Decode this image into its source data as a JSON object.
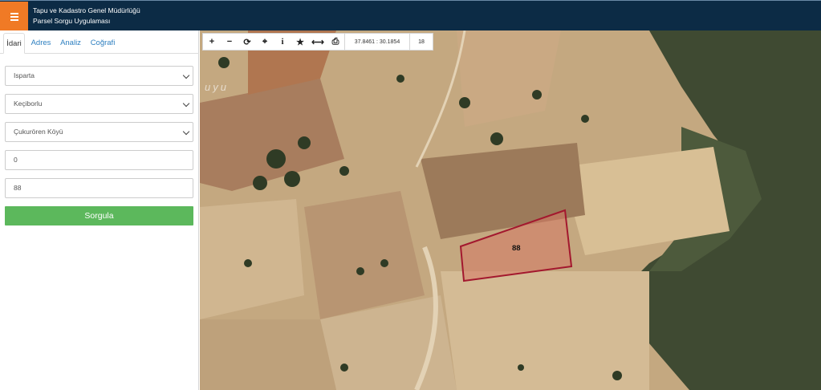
{
  "header": {
    "title": "Tapu ve Kadastro Genel Müdürlüğü",
    "subtitle": "Parsel Sorgu Uygulaması",
    "menu_icon": "hamburger-icon",
    "colors": {
      "background": "#0c2b45",
      "menu_button": "#f07a25"
    }
  },
  "sidebar": {
    "tabs": [
      {
        "label": "İdari",
        "active": true
      },
      {
        "label": "Adres"
      },
      {
        "label": "Analiz"
      },
      {
        "label": "Coğrafi"
      }
    ],
    "form": {
      "province": "Isparta",
      "district": "Keçiborlu",
      "neighborhood": "Çukurören Köyü",
      "block": "0",
      "parcel": "88",
      "submit_label": "Sorgula",
      "submit_color": "#5cb85c"
    }
  },
  "map": {
    "toolbar": {
      "zoom_in": "+",
      "zoom_out": "−",
      "refresh": "⟳",
      "locate": "⌖",
      "info": "i",
      "favorite": "★",
      "measure": "⟷",
      "print": "⎙",
      "coordinates": "37.8461 : 30.1854",
      "zoom_level": "18"
    },
    "overlay_text": "uyu",
    "parcel": {
      "label": "88",
      "outline_color": "#a3182e"
    }
  }
}
